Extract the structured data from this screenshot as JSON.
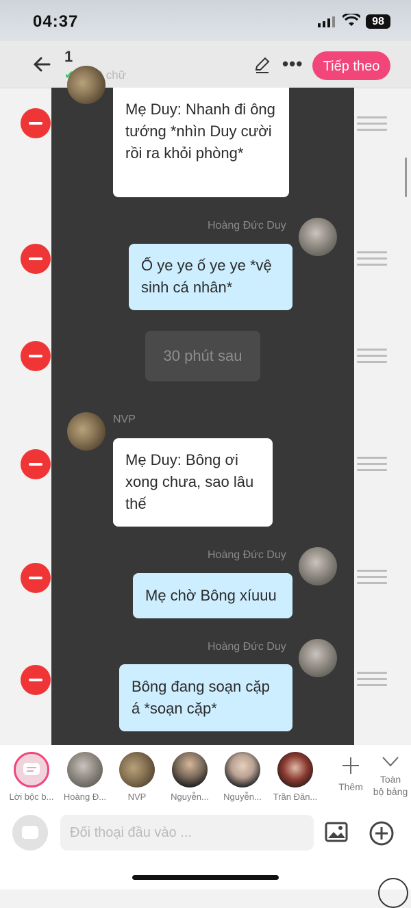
{
  "status": {
    "time": "04:37",
    "battery": "98"
  },
  "header": {
    "title": "1",
    "word_count": "1000 chữ",
    "next_label": "Tiếp theo",
    "more_label": "•••"
  },
  "messages": [
    {
      "type": "left",
      "text": "Mẹ Duy: Nhanh đi ông tướng *nhìn Duy cười rồi ra khỏi phòng*"
    },
    {
      "type": "right",
      "speaker": "Hoàng Đức Duy",
      "text": "Ố ye ye ố ye ye *vệ sinh cá nhân*"
    },
    {
      "type": "narration",
      "text": "30 phút sau"
    },
    {
      "type": "left",
      "speaker": "NVP",
      "text": "Mẹ Duy: Bông ơi xong chưa, sao lâu thế"
    },
    {
      "type": "right",
      "speaker": "Hoàng Đức Duy",
      "text": "Mẹ chờ Bông xíuuu"
    },
    {
      "type": "right",
      "speaker": "Hoàng Đức Duy",
      "text": "Bông đang soạn cặp á *soạn cặp*"
    }
  ],
  "cast": [
    {
      "label": "Lời bộc b...",
      "icon": "narration-icon"
    },
    {
      "label": "Hoàng Đ..."
    },
    {
      "label": "NVP"
    },
    {
      "label": "Nguyễn..."
    },
    {
      "label": "Nguyễn..."
    },
    {
      "label": "Trần Đăn..."
    }
  ],
  "cast_actions": {
    "add": "Thêm",
    "full_1": "Toàn",
    "full_2": "bộ bảng"
  },
  "input": {
    "placeholder": "Đối thoại đầu vào ..."
  }
}
